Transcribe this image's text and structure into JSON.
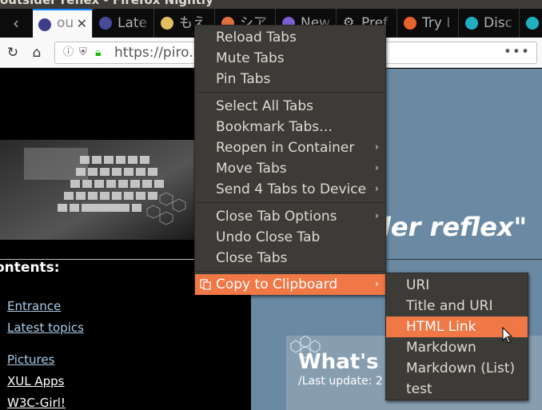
{
  "window": {
    "title": "outsider reflex - Firefox Nightly"
  },
  "tabs": [
    {
      "label": "ou",
      "selected": true,
      "close": "✕",
      "icon_color": "#3d3d8a"
    },
    {
      "label": "Late",
      "selected": false,
      "icon_color": "#4a4a9a"
    },
    {
      "label": "もえ",
      "selected": false,
      "icon_color": "#e0c060"
    },
    {
      "label": "シア",
      "selected": false,
      "icon_color": "#e07040"
    },
    {
      "label": "New",
      "selected": false,
      "icon_color": "#7a5fd0"
    },
    {
      "label": "Pref",
      "selected": false,
      "icon_color": "#bbbbbb"
    },
    {
      "label": "Try I",
      "selected": false,
      "icon_color": "#e8632b"
    },
    {
      "label": "Disc",
      "selected": false,
      "icon_color": "#20b0c0"
    },
    {
      "label": "",
      "selected": false,
      "icon_color": "#20b0c0"
    }
  ],
  "tab_scroll_left": "‹",
  "navbar": {
    "url": "https://piro.",
    "page_actions": "•••"
  },
  "page": {
    "contents_heading": "ontents:",
    "links": [
      "Entrance",
      "Latest topics",
      "Pictures",
      "XUL Apps",
      "W3C-Girl!"
    ],
    "headline": "der reflex\"",
    "news_title": "What's ne",
    "news_sub": "/Last update: 2"
  },
  "context_menu": {
    "items": [
      {
        "label": "Reload Tabs",
        "submenu": false
      },
      {
        "label": "Mute Tabs",
        "submenu": false
      },
      {
        "label": "Pin Tabs",
        "submenu": false
      },
      {
        "label": "Select All Tabs",
        "submenu": false
      },
      {
        "label": "Bookmark Tabs…",
        "submenu": false
      },
      {
        "label": "Reopen in Container",
        "submenu": true
      },
      {
        "label": "Move Tabs",
        "submenu": true
      },
      {
        "label": "Send 4 Tabs to Device",
        "submenu": true
      },
      {
        "label": "Close Tab Options",
        "submenu": true
      },
      {
        "label": "Undo Close Tab",
        "submenu": false
      },
      {
        "label": "Close Tabs",
        "submenu": false
      },
      {
        "label": "Copy to Clipboard",
        "submenu": true,
        "active": true
      }
    ],
    "arrow": "›"
  },
  "clipboard_submenu": {
    "items": [
      {
        "label": "URI"
      },
      {
        "label": "Title and URI"
      },
      {
        "label": "HTML Link",
        "active": true
      },
      {
        "label": "Markdown"
      },
      {
        "label": "Markdown (List)"
      },
      {
        "label": "test"
      }
    ]
  },
  "colors": {
    "menu_bg": "#3c3b37",
    "menu_text": "#dfdbd2",
    "menu_highlight": "#f07746",
    "tab_accent": "#0a84ff",
    "page_right_bg": "#6a8aa4",
    "link": "#aacce6"
  }
}
